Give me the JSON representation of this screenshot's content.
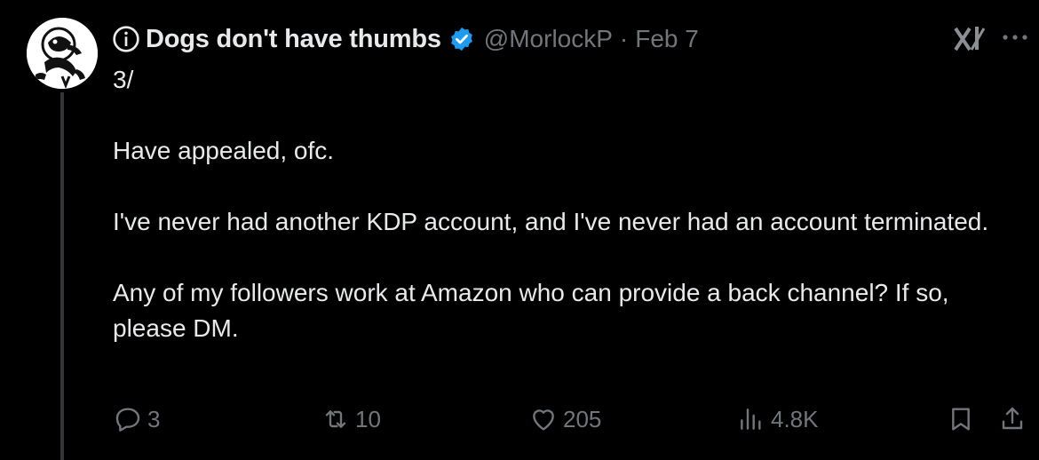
{
  "tweet": {
    "display_name": "Dogs don't have thumbs",
    "handle": "@MorlockP",
    "separator": "·",
    "date": "Feb 7",
    "paragraphs": [
      "3/",
      "Have appealed, ofc.",
      "I've never had another KDP account, and I've never had an account terminated.",
      "Any of my followers work at Amazon who can provide a back channel?  If so, please DM."
    ]
  },
  "stats": {
    "replies": "3",
    "reposts": "10",
    "likes": "205",
    "views": "4.8K"
  },
  "icons": {
    "info": "info-circle-icon",
    "verified": "verified-badge-icon",
    "grok": "grok-icon",
    "more": "more-options-icon",
    "reply": "reply-icon",
    "repost": "repost-icon",
    "like": "heart-icon",
    "views": "views-icon",
    "bookmark": "bookmark-icon",
    "share": "share-icon"
  },
  "colors": {
    "background": "#000000",
    "text": "#e7e9ea",
    "secondary": "#71767b",
    "verified": "#1d9bf0",
    "thread_line": "#333639"
  }
}
